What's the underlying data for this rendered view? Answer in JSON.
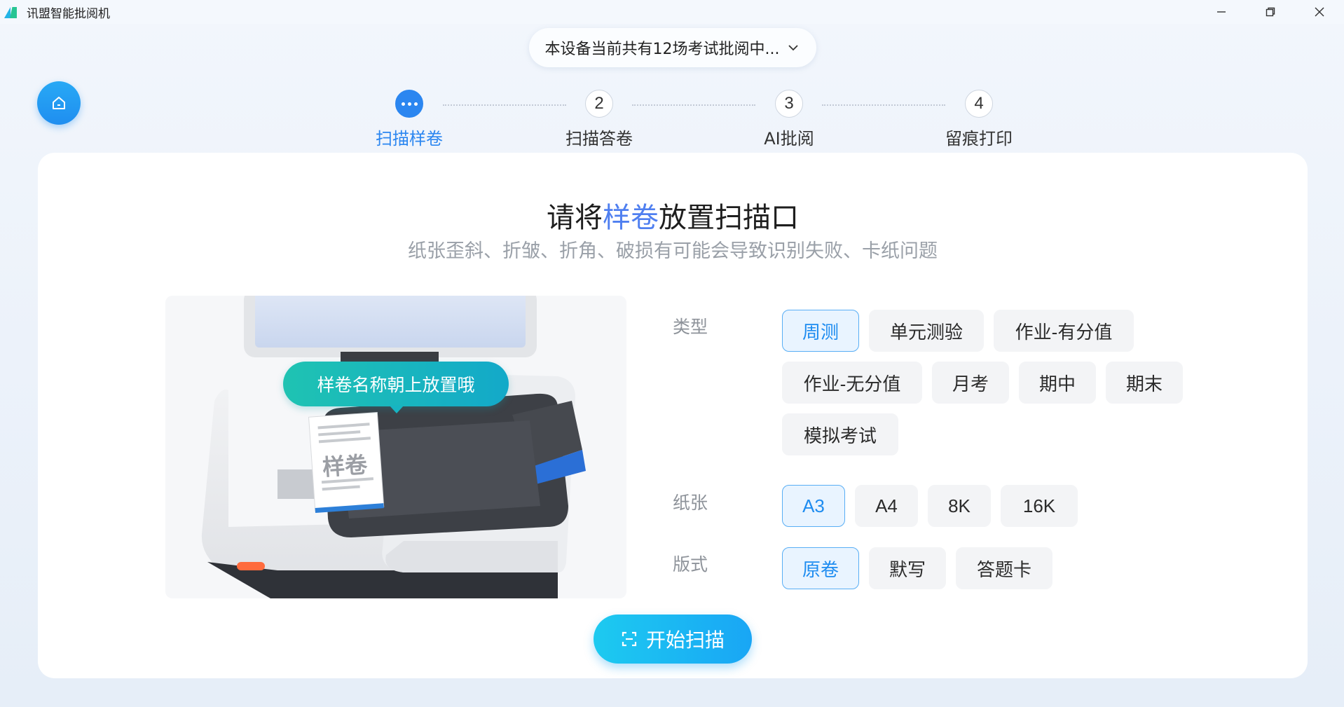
{
  "window": {
    "title": "讯盟智能批阅机",
    "controls": [
      "minimize-icon",
      "restore-icon",
      "close-icon"
    ]
  },
  "exam_selector": {
    "text": "本设备当前共有12场考试批阅中...",
    "icon": "chevron-down-icon"
  },
  "stepper": {
    "steps": [
      {
        "number": "",
        "label": "扫描样卷",
        "active": true
      },
      {
        "number": "2",
        "label": "扫描答卷",
        "active": false
      },
      {
        "number": "3",
        "label": "AI批阅",
        "active": false
      },
      {
        "number": "4",
        "label": "留痕打印",
        "active": false
      }
    ]
  },
  "main": {
    "title_pre": "请将",
    "title_highlight": "样卷",
    "title_post": "放置扫描口",
    "subtitle": "纸张歪斜、折皱、折角、破损有可能会导致识别失败、卡纸问题",
    "illustration_tip": "样卷名称朝上放置哦",
    "illustration_paper_text": "样卷"
  },
  "options": {
    "type": {
      "label": "类型",
      "items": [
        "周测",
        "单元测验",
        "作业-有分值",
        "作业-无分值",
        "月考",
        "期中",
        "期末",
        "模拟考试"
      ],
      "selected": "周测"
    },
    "paper": {
      "label": "纸张",
      "items": [
        "A3",
        "A4",
        "8K",
        "16K"
      ],
      "selected": "A3"
    },
    "format": {
      "label": "版式",
      "items": [
        "原卷",
        "默写",
        "答题卡"
      ],
      "selected": "原卷"
    }
  },
  "start_button": {
    "label": "开始扫描",
    "icon": "scan-icon"
  },
  "colors": {
    "accent": "#2b86f0",
    "selected_border": "#58aef5",
    "selected_bg": "#e9f4ff",
    "title_highlight": "#4f7ff0",
    "tip_bubble": "#1fc3b2",
    "start_button": "#19a6f5"
  }
}
